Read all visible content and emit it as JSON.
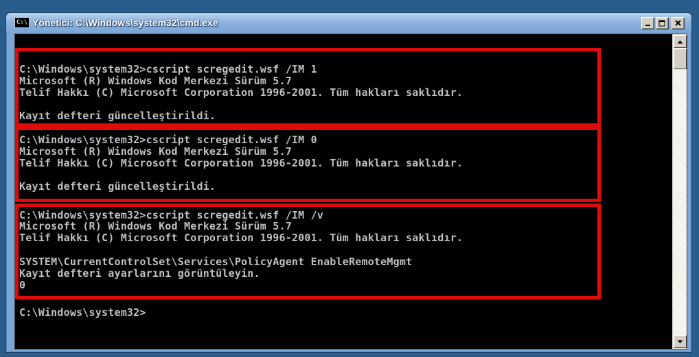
{
  "window": {
    "title": "Yönetici: C:\\Windows\\system32\\cmd.exe",
    "app_icon_text": "C:\\",
    "buttons": {
      "minimize": "_",
      "maximize": "□",
      "close": "✕"
    }
  },
  "console": {
    "blocks": [
      {
        "lines": [
          "C:\\Windows\\system32>cscript scregedit.wsf /IM 1",
          "Microsoft (R) Windows Kod Merkezi Sürüm 5.7",
          "Telif Hakkı (C) Microsoft Corporation 1996-2001. Tüm hakları saklıdır.",
          "",
          "Kayıt defteri güncelleştirildi."
        ]
      },
      {
        "lines": [
          "C:\\Windows\\system32>cscript scregedit.wsf /IM 0",
          "Microsoft (R) Windows Kod Merkezi Sürüm 5.7",
          "Telif Hakkı (C) Microsoft Corporation 1996-2001. Tüm hakları saklıdır.",
          "",
          "Kayıt defteri güncelleştirildi."
        ]
      },
      {
        "lines": [
          "C:\\Windows\\system32>cscript scregedit.wsf /IM /v",
          "Microsoft (R) Windows Kod Merkezi Sürüm 5.7",
          "Telif Hakkı (C) Microsoft Corporation 1996-2001. Tüm hakları saklıdır.",
          "",
          "SYSTEM\\CurrentControlSet\\Services\\PolicyAgent EnableRemoteMgmt",
          "Kayıt defteri ayarlarını görüntüleyin.",
          "0"
        ]
      }
    ],
    "prompt": "C:\\Windows\\system32>",
    "highlight_color": "#e10a0a",
    "text_color": "#c0c0c0",
    "background_color": "#000000"
  },
  "scrollbar": {
    "up_icon": "arrow-up-icon",
    "down_icon": "arrow-down-icon"
  }
}
